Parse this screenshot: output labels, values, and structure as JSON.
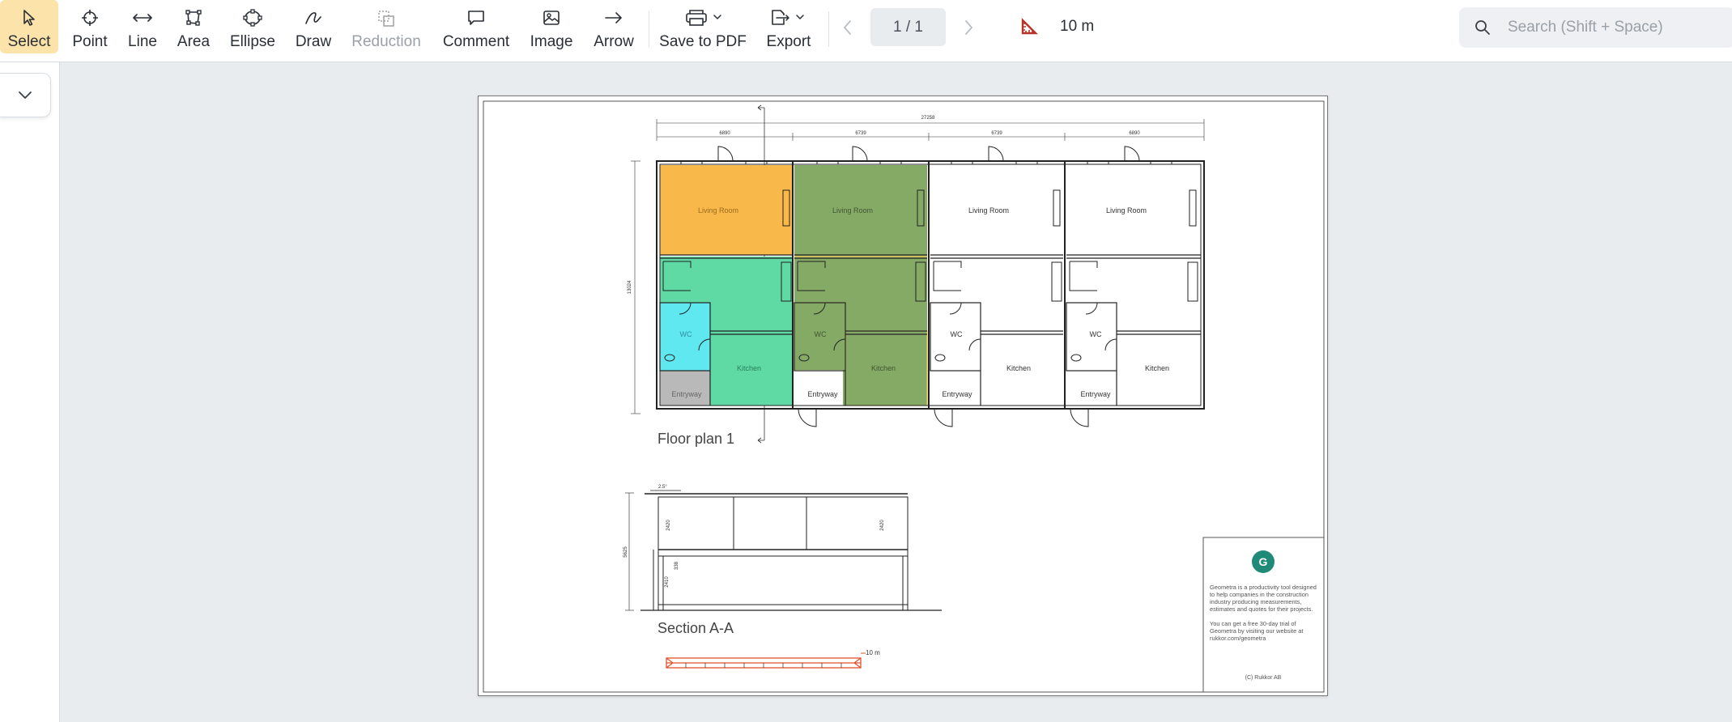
{
  "toolbar": {
    "tools": [
      {
        "label": "Select",
        "icon": "cursor-arrow-icon",
        "active": true
      },
      {
        "label": "Point",
        "icon": "crosshair-icon"
      },
      {
        "label": "Line",
        "icon": "double-arrow-icon"
      },
      {
        "label": "Area",
        "icon": "polygon-icon"
      },
      {
        "label": "Ellipse",
        "icon": "ellipse-icon"
      },
      {
        "label": "Draw",
        "icon": "freehand-icon"
      },
      {
        "label": "Reduction",
        "icon": "reduction-icon",
        "disabled": true
      },
      {
        "label": "Comment",
        "icon": "speech-bubble-icon"
      },
      {
        "label": "Image",
        "icon": "image-icon"
      },
      {
        "label": "Arrow",
        "icon": "arrow-right-icon"
      },
      {
        "label": "Save to PDF",
        "icon": "printer-icon"
      },
      {
        "label": "Export",
        "icon": "export-icon"
      }
    ],
    "page_indicator": "1 / 1",
    "scale_label": "10 m",
    "search_placeholder": "Search (Shift + Space)"
  },
  "drawing": {
    "floor_plan_title": "Floor plan 1",
    "section_title": "Section A-A",
    "rooms": {
      "living_room": "Living Room",
      "wc": "WC",
      "kitchen": "Kitchen",
      "entryway": "Entryway"
    },
    "dimensions": {
      "total_width": "27258",
      "unit_a": "6890",
      "unit_b": "6739",
      "unit_c": "6739",
      "unit_d": "6890",
      "depth": "13024",
      "section_height": "5625",
      "section_h1": "2420",
      "section_h2": "2420",
      "section_h3": "2410",
      "section_h4": "338",
      "roof_pitch": "2.5°"
    },
    "scale_bar_label": "10 m",
    "colors": {
      "living_room_1": "#f8b94a",
      "main_area_1": "#5fdaa5",
      "wc_1": "#5fe8f0",
      "entryway_1": "#b9b9b9",
      "unit_2": "#84aa66",
      "scale_bar": "#e0502a",
      "brand_green": "#1f8a78",
      "active_tool_bg": "#fbe3a9"
    },
    "title_block": {
      "logo_letter": "G",
      "description": "Geometra is a productivity tool designed to help companies in the construction industry producing measurements, estimates and quotes for their projects.",
      "trial_text": "You can get a free 30-day trial of Geometra by visiting our website at rukkor.com/geometra",
      "copyright": "(C) Rukkor AB"
    }
  }
}
